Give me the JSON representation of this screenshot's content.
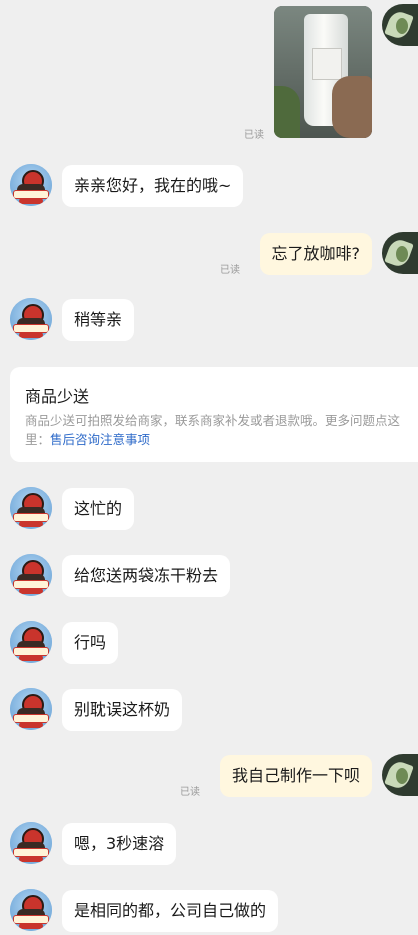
{
  "messages": [
    {
      "id": "m0",
      "side": "right",
      "type": "image",
      "read": "已读",
      "image_alt": "photo of milk tea cup"
    },
    {
      "id": "m1",
      "side": "left",
      "text": "亲亲您好，我在的哦~"
    },
    {
      "id": "m2",
      "side": "right",
      "text": "忘了放咖啡?",
      "read": "已读"
    },
    {
      "id": "m3",
      "side": "left",
      "text": "稍等亲"
    },
    {
      "id": "card",
      "type": "card",
      "title": "商品少送",
      "desc": "商品少送可拍照发给商家，联系商家补发或者退款哦。更多问题点这里：",
      "link": "售后咨询注意事项"
    },
    {
      "id": "m4",
      "side": "left",
      "text": "这忙的"
    },
    {
      "id": "m5",
      "side": "left",
      "text": "给您送两袋冻干粉去"
    },
    {
      "id": "m6",
      "side": "left",
      "text": "行吗"
    },
    {
      "id": "m7",
      "side": "left",
      "text": "别耽误这杯奶"
    },
    {
      "id": "m8",
      "side": "right",
      "text": "我自己制作一下呗",
      "read": "已读"
    },
    {
      "id": "m9",
      "side": "left",
      "text": "嗯，3秒速溶"
    },
    {
      "id": "m10",
      "side": "left",
      "text": "是相同的都，公司自己做的"
    }
  ],
  "colors": {
    "background": "#efefef",
    "bubble_left": "#ffffff",
    "bubble_right": "#fff7df",
    "link": "#2f6bc9",
    "muted": "#9a9a9a"
  }
}
